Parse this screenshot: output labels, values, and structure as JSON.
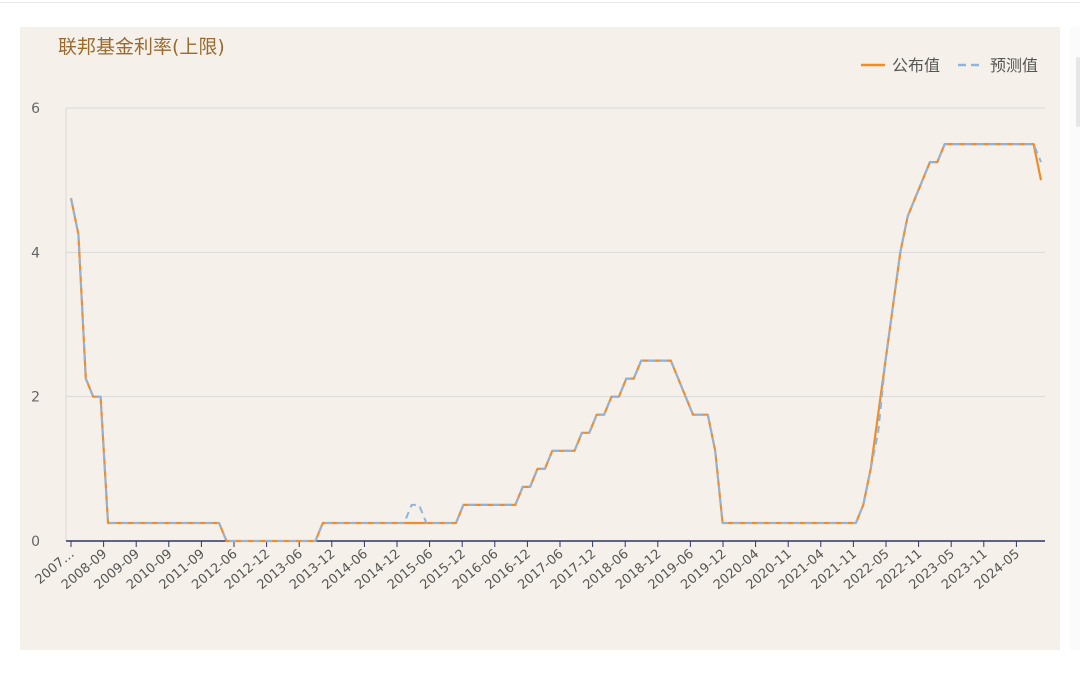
{
  "colors": {
    "published": "#f28c28",
    "forecast": "#8fb4de",
    "axis": "#2f3563",
    "grid": "#d9d9d9",
    "title": "#9a6a2e"
  },
  "chart_data": {
    "type": "line",
    "title": "联邦基金利率(上限)",
    "xlabel": "",
    "ylabel": "",
    "ylim": [
      0,
      6
    ],
    "yticks": [
      "0",
      "2",
      "4",
      "6"
    ],
    "grid": true,
    "legend_position": "top-right",
    "legend": [
      {
        "name": "公布值",
        "style": "solid"
      },
      {
        "name": "预测值",
        "style": "dashed"
      }
    ],
    "x_tick_labels": [
      "2007…",
      "2008-09",
      "2009-09",
      "2010-09",
      "2011-09",
      "2012-06",
      "2012-12",
      "2013-06",
      "2013-12",
      "2014-06",
      "2014-12",
      "2015-06",
      "2015-12",
      "2016-06",
      "2016-12",
      "2017-06",
      "2017-12",
      "2018-06",
      "2018-12",
      "2019-06",
      "2019-12",
      "2020-04",
      "2020-11",
      "2021-04",
      "2021-11",
      "2022-05",
      "2022-11",
      "2023-05",
      "2023-11",
      "2024-05"
    ],
    "series": [
      {
        "name": "公布值",
        "style": "solid",
        "values": [
          4.75,
          4.25,
          2.25,
          2.0,
          2.0,
          0.25,
          0.25,
          0.25,
          0.25,
          0.25,
          0.25,
          0.25,
          0.25,
          0.25,
          0.25,
          0.25,
          0.25,
          0.25,
          0.25,
          0.25,
          0.25,
          0.0,
          0.0,
          0.0,
          0.0,
          0.0,
          0.0,
          0.0,
          0.0,
          0.0,
          0.0,
          0.0,
          0.0,
          0.0,
          0.25,
          0.25,
          0.25,
          0.25,
          0.25,
          0.25,
          0.25,
          0.25,
          0.25,
          0.25,
          0.25,
          0.25,
          0.25,
          0.25,
          0.25,
          0.25,
          0.25,
          0.25,
          0.25,
          0.5,
          0.5,
          0.5,
          0.5,
          0.5,
          0.5,
          0.5,
          0.5,
          0.75,
          0.75,
          1.0,
          1.0,
          1.25,
          1.25,
          1.25,
          1.25,
          1.5,
          1.5,
          1.75,
          1.75,
          2.0,
          2.0,
          2.25,
          2.25,
          2.5,
          2.5,
          2.5,
          2.5,
          2.5,
          2.25,
          2.0,
          1.75,
          1.75,
          1.75,
          1.25,
          0.25,
          0.25,
          0.25,
          0.25,
          0.25,
          0.25,
          0.25,
          0.25,
          0.25,
          0.25,
          0.25,
          0.25,
          0.25,
          0.25,
          0.25,
          0.25,
          0.25,
          0.25,
          0.25,
          0.5,
          1.0,
          1.75,
          2.5,
          3.25,
          4.0,
          4.5,
          4.75,
          5.0,
          5.25,
          5.25,
          5.5,
          5.5,
          5.5,
          5.5,
          5.5,
          5.5,
          5.5,
          5.5,
          5.5,
          5.5,
          5.5,
          5.5,
          5.5,
          5.0
        ]
      },
      {
        "name": "预测值",
        "style": "dashed",
        "values": [
          4.75,
          4.25,
          2.25,
          2.0,
          2.0,
          0.25,
          0.25,
          0.25,
          0.25,
          0.25,
          0.25,
          0.25,
          0.25,
          0.25,
          0.25,
          0.25,
          0.25,
          0.25,
          0.25,
          0.25,
          0.25,
          0.0,
          0.0,
          0.0,
          0.0,
          0.0,
          0.0,
          0.0,
          0.0,
          0.0,
          0.0,
          0.0,
          0.0,
          0.0,
          0.25,
          0.25,
          0.25,
          0.25,
          0.25,
          0.25,
          0.25,
          0.25,
          0.25,
          0.25,
          0.25,
          0.25,
          0.5,
          0.5,
          0.25,
          0.25,
          0.25,
          0.25,
          0.25,
          0.5,
          0.5,
          0.5,
          0.5,
          0.5,
          0.5,
          0.5,
          0.5,
          0.75,
          0.75,
          1.0,
          1.0,
          1.25,
          1.25,
          1.25,
          1.25,
          1.5,
          1.5,
          1.75,
          1.75,
          2.0,
          2.0,
          2.25,
          2.25,
          2.5,
          2.5,
          2.5,
          2.5,
          2.5,
          2.25,
          2.0,
          1.75,
          1.75,
          1.75,
          1.25,
          0.25,
          0.25,
          0.25,
          0.25,
          0.25,
          0.25,
          0.25,
          0.25,
          0.25,
          0.25,
          0.25,
          0.25,
          0.25,
          0.25,
          0.25,
          0.25,
          0.25,
          0.25,
          0.25,
          0.5,
          1.0,
          1.5,
          2.5,
          3.25,
          4.0,
          4.5,
          4.75,
          5.0,
          5.25,
          5.25,
          5.5,
          5.5,
          5.5,
          5.5,
          5.5,
          5.5,
          5.5,
          5.5,
          5.5,
          5.5,
          5.5,
          5.5,
          5.5,
          5.25
        ]
      }
    ]
  }
}
